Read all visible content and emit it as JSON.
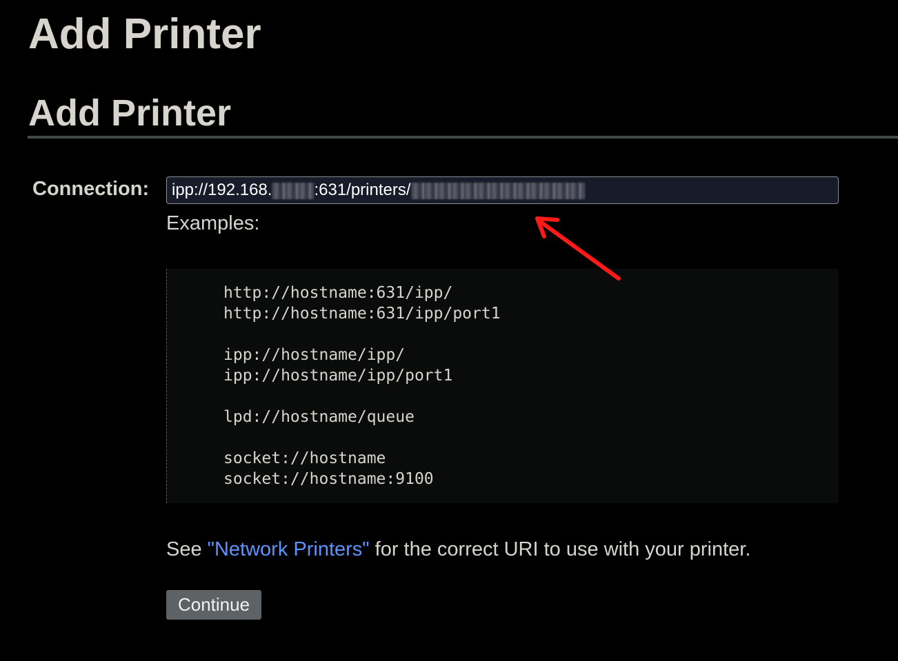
{
  "page": {
    "title": "Add Printer"
  },
  "section": {
    "title": "Add Printer"
  },
  "connection": {
    "label": "Connection:",
    "value_prefix": "ipp://192.168.",
    "value_middle": ":631/printers/"
  },
  "examples": {
    "label": "Examples:",
    "groups": [
      [
        "http://hostname:631/ipp/",
        "http://hostname:631/ipp/port1"
      ],
      [
        "ipp://hostname/ipp/",
        "ipp://hostname/ipp/port1"
      ],
      [
        "lpd://hostname/queue"
      ],
      [
        "socket://hostname",
        "socket://hostname:9100"
      ]
    ]
  },
  "hint": {
    "before": "See ",
    "link": "\"Network Printers\"",
    "after": " for the correct URI to use with your printer."
  },
  "actions": {
    "continue_label": "Continue"
  },
  "colors": {
    "background": "#000000",
    "text": "#d7d3cd",
    "link": "#5e93ff",
    "annotation_arrow": "#ff1a1a"
  },
  "icons": {
    "annotation": "red-arrow-icon"
  }
}
